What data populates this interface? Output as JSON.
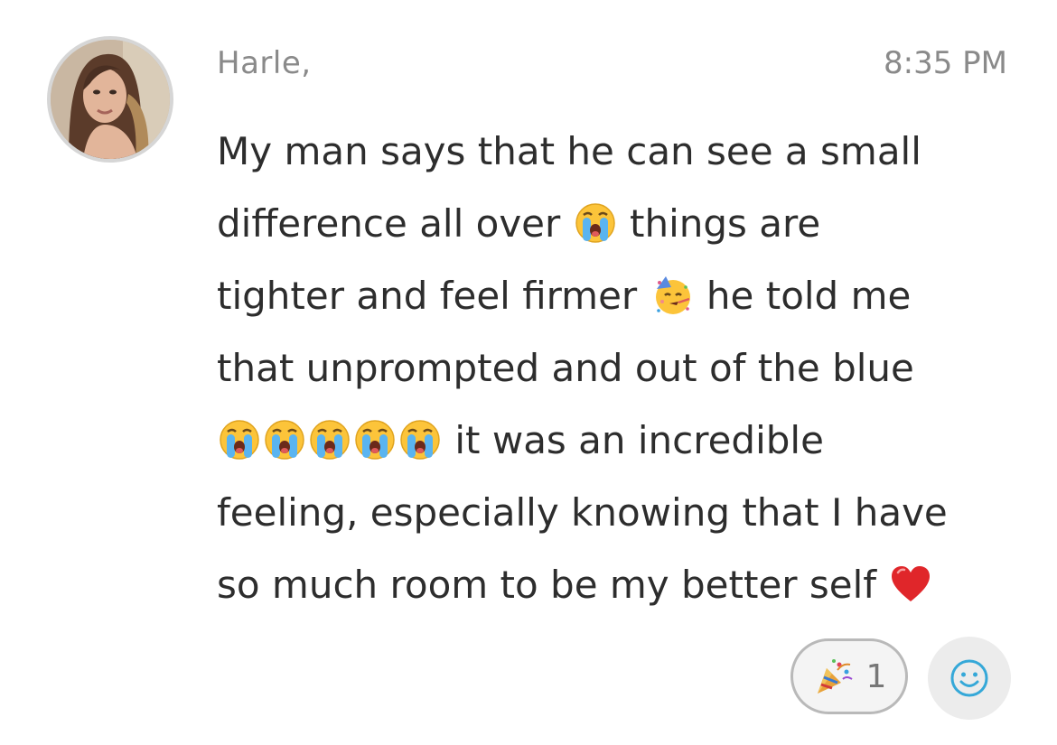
{
  "message": {
    "sender": "Harle, ",
    "time": "8:35 PM",
    "lines": [
      {
        "parts": [
          {
            "t": "text",
            "v": "My man says that he can see a small"
          }
        ]
      },
      {
        "parts": [
          {
            "t": "text",
            "v": "difference all over "
          },
          {
            "t": "emoji",
            "v": "crying-face"
          },
          {
            "t": "text",
            "v": " things are"
          }
        ]
      },
      {
        "parts": [
          {
            "t": "text",
            "v": "tighter and feel firmer "
          },
          {
            "t": "emoji",
            "v": "partying-face"
          },
          {
            "t": "text",
            "v": " he told me"
          }
        ]
      },
      {
        "parts": [
          {
            "t": "text",
            "v": "that unprompted and out of the blue"
          }
        ]
      },
      {
        "parts": [
          {
            "t": "emoji",
            "v": "crying-face"
          },
          {
            "t": "emoji",
            "v": "crying-face"
          },
          {
            "t": "emoji",
            "v": "crying-face"
          },
          {
            "t": "emoji",
            "v": "crying-face"
          },
          {
            "t": "emoji",
            "v": "crying-face"
          },
          {
            "t": "text",
            "v": " it was an incredible"
          }
        ]
      },
      {
        "parts": [
          {
            "t": "text",
            "v": "feeling, especially knowing that I have"
          }
        ]
      },
      {
        "parts": [
          {
            "t": "text",
            "v": "so much room to be my better self "
          },
          {
            "t": "emoji",
            "v": "red-heart"
          }
        ]
      }
    ]
  },
  "reactions": {
    "items": [
      {
        "emoji": "party-popper",
        "count": "1"
      }
    ],
    "add_icon": "smiley-icon"
  },
  "colors": {
    "text": "#2d2d2d",
    "meta": "#8a8a8a",
    "pill_border": "#b9b9b9",
    "add_bg": "#ececec",
    "add_icon": "#35a8d8"
  }
}
